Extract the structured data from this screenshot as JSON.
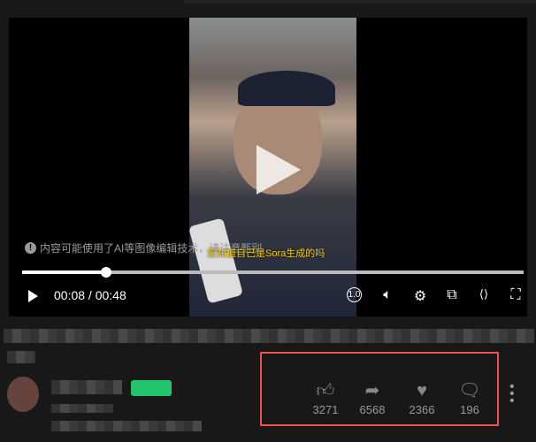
{
  "player": {
    "warning": "内容可能使用了AI等图像编辑技术，请注意甄别",
    "subtitle": "您知道自己是Sora生成的吗",
    "current_time": "00:08",
    "duration": "00:48",
    "time_display": "00:08 / 00:48",
    "progress_fraction": 0.167,
    "speed_label": "1.0"
  },
  "actions": [
    {
      "name": "like",
      "icon": "thumbs-up-icon",
      "count": "3271"
    },
    {
      "name": "share",
      "icon": "share-arrow-icon",
      "count": "6568"
    },
    {
      "name": "favorite",
      "icon": "heart-icon",
      "count": "2366"
    },
    {
      "name": "comment",
      "icon": "comment-icon",
      "count": "196"
    }
  ],
  "colors": {
    "highlight_box": "#f05050",
    "badge": "#22c56a",
    "subtitle": "#ffd400"
  }
}
